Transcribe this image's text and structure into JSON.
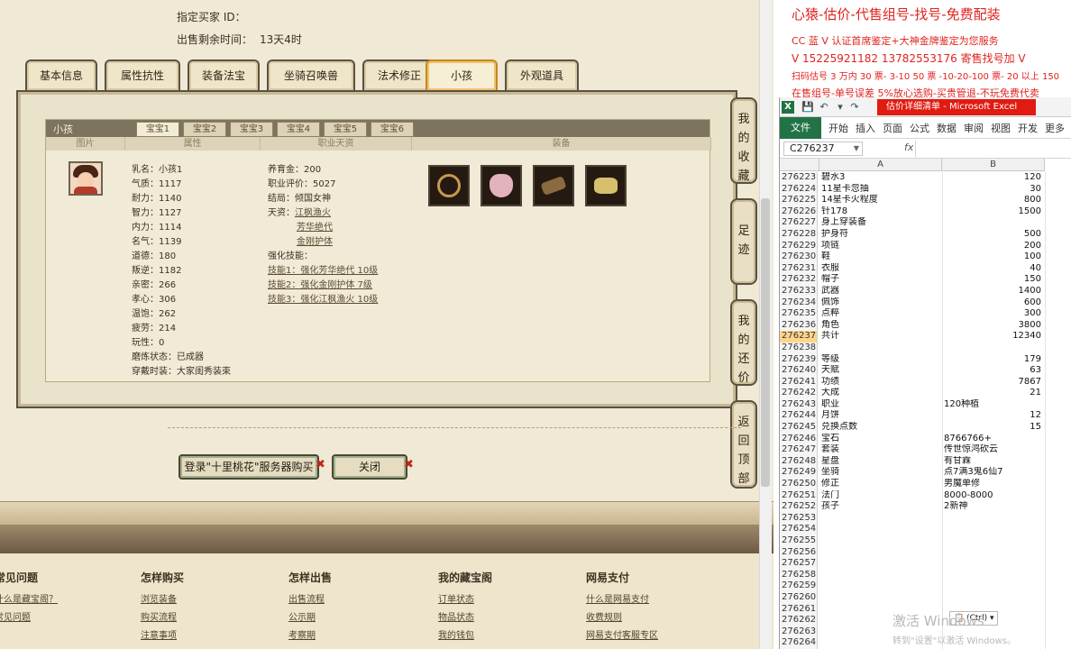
{
  "game": {
    "seller_label": "指定买家 ID：",
    "time_label": "出售剩余时间：",
    "time_value": "13天4时",
    "tabs": [
      "基本信息",
      "属性抗性",
      "装备法宝",
      "坐骑召唤兽",
      "法术修正",
      "小孩",
      "外观道具"
    ],
    "active_tab": "小孩",
    "panel_title": "小孩",
    "subtabs": [
      "宝宝1",
      "宝宝2",
      "宝宝3",
      "宝宝4",
      "宝宝5",
      "宝宝6"
    ],
    "col_headers": [
      "图片",
      "属性",
      "职业天资",
      "装备"
    ],
    "attrs": [
      "乳名：小孩1",
      "气质：1117",
      "耐力：1140",
      "智力：1127",
      "内力：1114",
      "名气：1139",
      "道德：180",
      "叛逆：1182",
      "亲密：266",
      "孝心：306",
      "温饱：262",
      "疲劳：214",
      "玩性：0",
      "磨炼状态：已成器",
      "穿戴时装：大家闺秀装束"
    ],
    "col2": {
      "l1": "养育金：200",
      "l2": "职业评价：5027",
      "l3": "结局：倾国女神",
      "talent_label": "天资：",
      "talent1": "江枫渔火",
      "talent2": "芳华绝代",
      "talent3": "金刚护体",
      "skill_label": "强化技能：",
      "skill1": "技能1：强化芳华绝代 10级",
      "skill2": "技能2：强化金刚护体 7级",
      "skill3": "技能3：强化江枫渔火 10级"
    },
    "equip_colors": [
      "#c89a4e",
      "#e3b3bd",
      "#8a6a3f",
      "#d6c06b"
    ],
    "side_buttons": [
      "我的收藏",
      "足迹",
      "我的还价",
      "返回顶部"
    ],
    "buy_button": "登录\"十里桃花\"服务器购买",
    "close_button": "关闭",
    "footer": [
      {
        "title": "常见问题",
        "items": [
          "什么是藏宝阁？",
          "常见问题",
          ""
        ]
      },
      {
        "title": "怎样购买",
        "items": [
          "浏览装备",
          "购买流程",
          "注意事项"
        ]
      },
      {
        "title": "怎样出售",
        "items": [
          "出售流程",
          "公示期",
          "考察期"
        ]
      },
      {
        "title": "我的藏宝阁",
        "items": [
          "订单状态",
          "物品状态",
          "我的钱包"
        ]
      },
      {
        "title": "网易支付",
        "items": [
          "什么是网易支付",
          "收费规则",
          "网易支付客服专区"
        ]
      }
    ]
  },
  "ad": {
    "line1": "心猿-估价-代售组号-找号-免费配装",
    "line2": "CC 蓝 V 认证首席鉴定+大神金牌鉴定为您服务",
    "line3": "V 15225921182      13782553176    寄售找号加 V",
    "line4": "扫码估号 3 万内 30 票- 3-10 50 票  -10-20-100 票- 20 以上 150",
    "line5": "在售组号-单号误差 5%放心选购-买贵管退-不玩免费代卖"
  },
  "excel": {
    "logo": "X",
    "window_title": "估价详细清单 - Microsoft Excel",
    "ribbon": [
      "文件",
      "开始",
      "插入",
      "页面",
      "公式",
      "数据",
      "审阅",
      "视图",
      "开发",
      "更多"
    ],
    "name_box": "C276237",
    "fx": "fx",
    "col_a": "A",
    "col_b": "B",
    "paste_tag": "(Ctrl)",
    "rows": [
      [
        "276223",
        "碧水3",
        "120"
      ],
      [
        "276224",
        "11星卡忽抽",
        "30"
      ],
      [
        "276225",
        "14星卡火程度",
        "800"
      ],
      [
        "276226",
        "针178",
        "1500"
      ],
      [
        "276227",
        "身上穿装备",
        ""
      ],
      [
        "276228",
        "护身符",
        "500"
      ],
      [
        "276229",
        "项链",
        "200"
      ],
      [
        "276230",
        "鞋",
        "100"
      ],
      [
        "276231",
        "衣服",
        "40"
      ],
      [
        "276232",
        "帽子",
        "150"
      ],
      [
        "276233",
        "武器",
        "1400"
      ],
      [
        "276234",
        "佩饰",
        "600"
      ],
      [
        "276235",
        "点粹",
        "300"
      ],
      [
        "276236",
        "角色",
        "3800"
      ],
      [
        "276237",
        "共计",
        "12340"
      ],
      [
        "276238",
        "",
        ""
      ],
      [
        "276239",
        "等级",
        "179"
      ],
      [
        "276240",
        "天赋",
        "63"
      ],
      [
        "276241",
        "功绩",
        "7867"
      ],
      [
        "276242",
        "大成",
        "21"
      ],
      [
        "276243",
        "职业",
        "120种植"
      ],
      [
        "276244",
        "月饼",
        "12"
      ],
      [
        "276245",
        "兑换点数",
        "15"
      ],
      [
        "276246",
        "宝石",
        "8766766+"
      ],
      [
        "276247",
        "套装",
        "传世惊鸿砍云"
      ],
      [
        "276248",
        "星盘",
        "有甘霖"
      ],
      [
        "276249",
        "坐骑",
        "点7满3鬼6仙7"
      ],
      [
        "276250",
        "修正",
        "男魔单修"
      ],
      [
        "276251",
        "法门",
        "8000-8000"
      ],
      [
        "276252",
        "孩子",
        "2新神"
      ],
      [
        "276253",
        "",
        ""
      ],
      [
        "276254",
        "",
        ""
      ],
      [
        "276255",
        "",
        ""
      ],
      [
        "276256",
        "",
        ""
      ],
      [
        "276257",
        "",
        ""
      ],
      [
        "276258",
        "",
        ""
      ],
      [
        "276259",
        "",
        ""
      ],
      [
        "276260",
        "",
        ""
      ],
      [
        "276261",
        "",
        ""
      ],
      [
        "276262",
        "",
        ""
      ],
      [
        "276263",
        "",
        ""
      ],
      [
        "276264",
        "",
        ""
      ]
    ]
  },
  "watermark": {
    "line1": "激活 Windows",
    "line2": "转到\"设置\"以激活 Windows。"
  }
}
